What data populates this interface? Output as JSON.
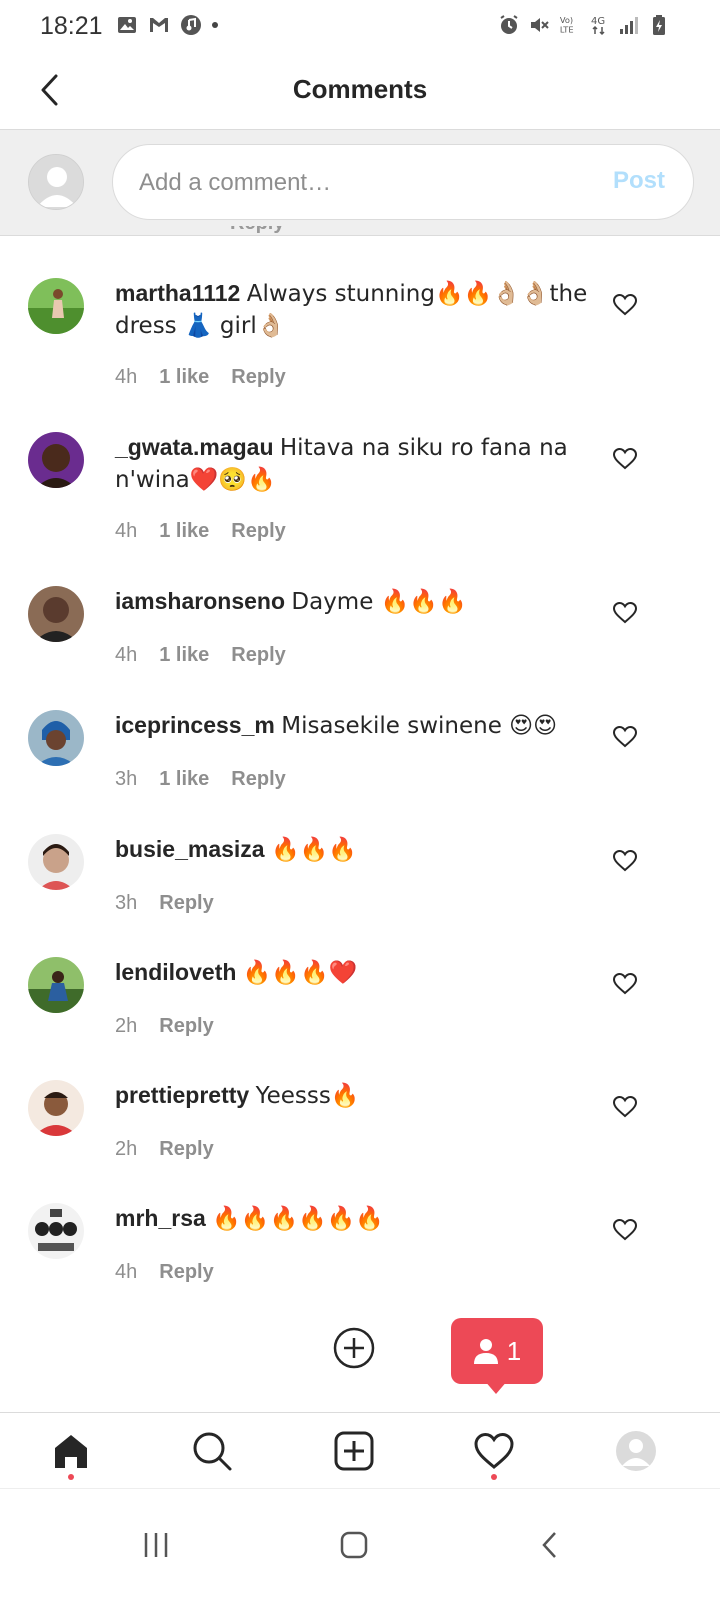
{
  "status_bar": {
    "time": "18:21",
    "network_label": "4G",
    "volte_label": "VoLTE"
  },
  "header": {
    "title": "Comments"
  },
  "composer": {
    "placeholder": "Add a comment…",
    "post_label": "Post",
    "post_color": "#b2dffc"
  },
  "comments": [
    {
      "username": "martha1112",
      "text": "Always stunning🔥🔥👌🏼👌🏼the dress 👗 girl👌🏼",
      "time": "4h",
      "likes": "1 like",
      "reply": "Reply",
      "avatar_color": "#6aa84f"
    },
    {
      "username": "_gwata.magau",
      "text": "Hitava na siku ro fana na n'wina❤️🥺🔥",
      "time": "4h",
      "likes": "1 like",
      "reply": "Reply",
      "avatar_color": "#6a2c8f"
    },
    {
      "username": "iamsharonseno",
      "text": "Dayme 🔥🔥🔥",
      "time": "4h",
      "likes": "1 like",
      "reply": "Reply",
      "avatar_color": "#5a3b2e"
    },
    {
      "username": "iceprincess_m",
      "text": "Misasekile swinene 😍😍",
      "time": "3h",
      "likes": "1 like",
      "reply": "Reply",
      "avatar_color": "#2d6fb3"
    },
    {
      "username": "busie_masiza",
      "text": "🔥🔥🔥",
      "time": "3h",
      "likes": "",
      "reply": "Reply",
      "avatar_color": "#c9a28a"
    },
    {
      "username": "lendiloveth",
      "text": "🔥🔥🔥❤️",
      "time": "2h",
      "likes": "",
      "reply": "Reply",
      "avatar_color": "#3f6b2a"
    },
    {
      "username": "prettiepretty",
      "text": "Yeesss🔥",
      "time": "2h",
      "likes": "",
      "reply": "Reply",
      "avatar_color": "#d9383a"
    },
    {
      "username": "mrh_rsa",
      "text": "🔥🔥🔥🔥🔥🔥",
      "time": "4h",
      "likes": "",
      "reply": "Reply",
      "avatar_color": "#222222"
    }
  ],
  "notification": {
    "count": "1",
    "color": "#ed4956"
  },
  "bottom_nav": {
    "items": [
      "home-icon",
      "search-icon",
      "new-post-icon",
      "activity-heart-icon",
      "profile-icon"
    ]
  },
  "accent": {
    "text": "#262626",
    "muted": "#8e8e8e",
    "divider": "#dbdbdb"
  }
}
